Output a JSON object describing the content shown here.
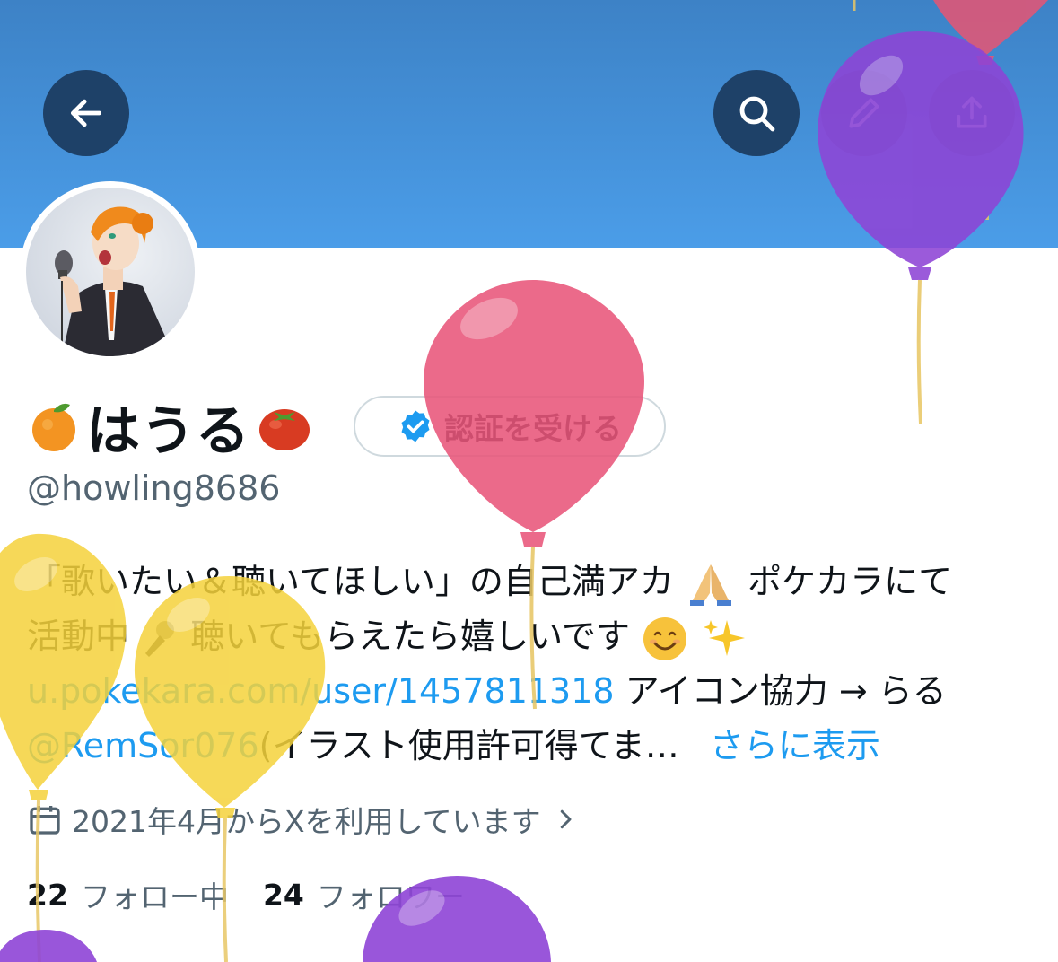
{
  "profile": {
    "display_name": "はうる",
    "handle": "@howling8686",
    "verify_label": "認証を受ける",
    "name_emoji_left": "orange-emoji",
    "name_emoji_right": "tomato-emoji"
  },
  "bio": {
    "line1_text": "「歌いたい＆聴いてほしい」の自己満アカ",
    "line1_after_emoji": " ポケカラにて",
    "line2_text": "活動中",
    "line2_middle": " 聴いてもらえたら嬉しいです",
    "line3_link": "u.pokekara.com/user/1457811318",
    "line3_text": " アイコン協力 → らる",
    "line4_mention": "@RemSor076",
    "line4_text": "(イラスト使用許可得てま…",
    "more_label": "さらに表示"
  },
  "joined": {
    "text": "2021年4月からXを利用しています",
    "icon": "calendar-icon"
  },
  "stats": {
    "following_count": "22",
    "following_label": "フォロー中",
    "followers_count": "24",
    "followers_label": "フォロワー"
  },
  "toolbar": {
    "back_icon": "arrow-left-icon",
    "search_icon": "search-icon",
    "edit_icon": "pencil-icon",
    "share_icon": "share-icon"
  },
  "colors": {
    "banner": "#4b9de8",
    "toolbar_button": "#1e4168",
    "link": "#1d9bf0",
    "secondary_text": "#536471",
    "verified_badge": "#1d9bf0"
  }
}
